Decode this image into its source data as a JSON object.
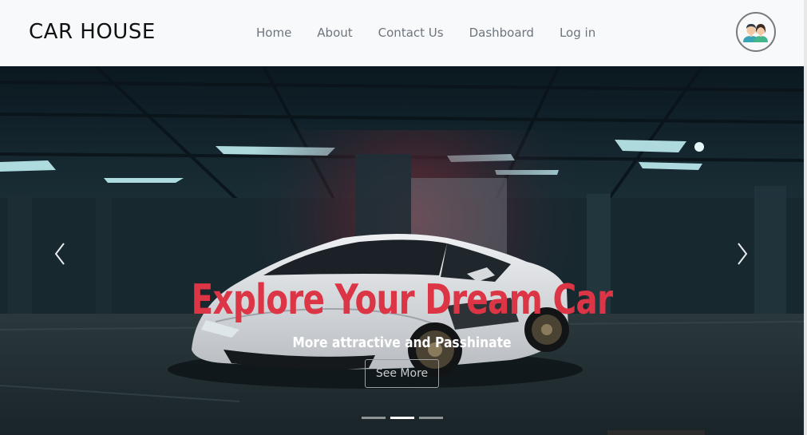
{
  "navbar": {
    "brand": "CAR HOUSE",
    "links": [
      {
        "label": "Home"
      },
      {
        "label": "About"
      },
      {
        "label": "Contact Us"
      },
      {
        "label": "Dashboard"
      },
      {
        "label": "Log in"
      }
    ],
    "avatar_icon": "users-avatar-icon"
  },
  "hero": {
    "title": "Explore Your Dream Car",
    "subtitle": "More attractive and Passhinate",
    "button_label": "See More",
    "prev_icon": "chevron-left-icon",
    "next_icon": "chevron-right-icon",
    "slide_count": 3,
    "active_slide": 2
  },
  "colors": {
    "accent": "#dc3545",
    "navbar_bg": "#f8f9fa",
    "nav_text": "#6c757d",
    "brand_text": "#111111"
  }
}
